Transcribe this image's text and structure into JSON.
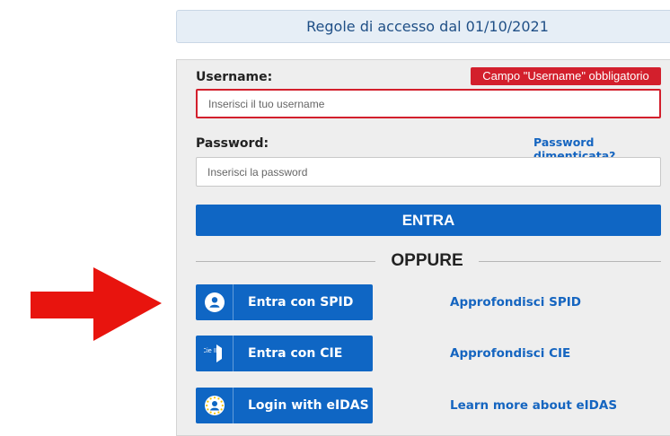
{
  "notice": {
    "text": "Regole di accesso dal 01/10/2021"
  },
  "login": {
    "username_label": "Username:",
    "username_error": "Campo \"Username\" obbligatorio",
    "username_placeholder": "Inserisci il tuo username",
    "password_label": "Password:",
    "password_placeholder": "Inserisci la password",
    "forgot_password": "Password dimenticata?",
    "submit_label": "ENTRA"
  },
  "separator": {
    "text": "OPPURE"
  },
  "identity_options": [
    {
      "button_label": "Entra con SPID",
      "icon": "spid-user-icon",
      "info_link": "Approfondisci SPID"
    },
    {
      "button_label": "Entra con CIE",
      "icon": "cie-id-icon",
      "icon_text": "Cie ID",
      "info_link": "Approfondisci CIE"
    },
    {
      "button_label": "Login with eIDAS",
      "icon": "eidas-user-icon",
      "info_link": "Learn more about eIDAS"
    }
  ],
  "colors": {
    "primary": "#0f66c4",
    "error": "#d31f2c",
    "arrow": "#e8140e",
    "link": "#1565c0"
  }
}
